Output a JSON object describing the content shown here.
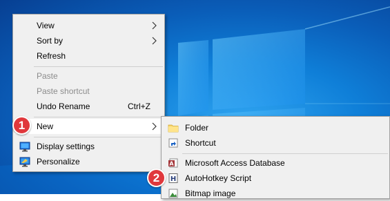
{
  "context_menu": {
    "items": [
      {
        "label": "View",
        "has_submenu": true
      },
      {
        "label": "Sort by",
        "has_submenu": true
      },
      {
        "label": "Refresh"
      },
      {
        "label": "Paste",
        "disabled": true
      },
      {
        "label": "Paste shortcut",
        "disabled": true
      },
      {
        "label": "Undo Rename",
        "shortcut": "Ctrl+Z"
      },
      {
        "label": "New",
        "has_submenu": true,
        "highlighted": true
      },
      {
        "label": "Display settings",
        "icon": "display-icon"
      },
      {
        "label": "Personalize",
        "icon": "personalize-icon"
      }
    ]
  },
  "new_submenu": {
    "items": [
      {
        "label": "Folder",
        "icon": "folder-icon"
      },
      {
        "label": "Shortcut",
        "icon": "shortcut-icon"
      },
      {
        "label": "Microsoft Access Database",
        "icon": "access-icon"
      },
      {
        "label": "AutoHotkey Script",
        "icon": "autohotkey-icon"
      },
      {
        "label": "Bitmap image",
        "icon": "bitmap-icon"
      }
    ]
  },
  "annotations": {
    "step1": "1",
    "step2": "2",
    "badge_color": "#e0383c"
  },
  "colors": {
    "menu_bg": "#f0f0f0",
    "highlight_bg": "#ffffff",
    "disabled_text": "#8c8c8c"
  }
}
